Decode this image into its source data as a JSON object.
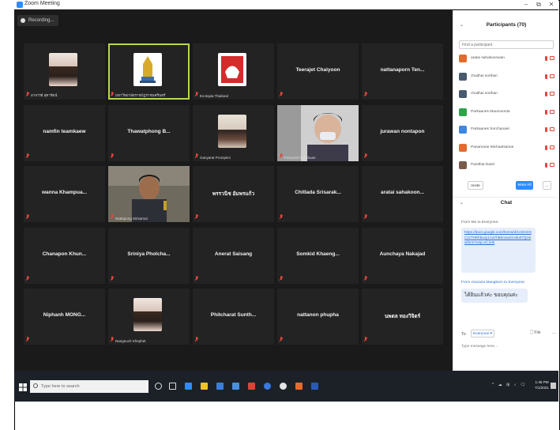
{
  "window": {
    "title": "Zoom Meeting",
    "minimize": "–",
    "maximize": "⧉",
    "close": "✕"
  },
  "recording": {
    "label": "Recording..."
  },
  "tiles": [
    {
      "name": "อาจารย์ สุดารัตน์",
      "type": "photo",
      "active": false
    },
    {
      "name": "มหาวิทยาลัยราชภัฏราชนครินทร์",
      "type": "logo",
      "active": true
    },
    {
      "name": "Ecotopia Thailand",
      "type": "logo2",
      "active": false
    },
    {
      "name": "Teerajet Chaiyoon",
      "type": "text",
      "active": false
    },
    {
      "name": "nattanaporn Ten...",
      "type": "text",
      "active": false
    },
    {
      "name": "namfin teamkaew",
      "type": "text",
      "active": false
    },
    {
      "name": "Thawatphong B...",
      "type": "text",
      "active": false
    },
    {
      "name": "Ganyarat Prompimi",
      "type": "photo2",
      "active": false
    },
    {
      "name": "Panyarat Rakchuan",
      "type": "cam",
      "active": false
    },
    {
      "name": "jurawan nontapon",
      "type": "text",
      "active": false
    },
    {
      "name": "wanna Khampua...",
      "type": "text",
      "active": false
    },
    {
      "name": "Nattapong Sirisamut",
      "type": "cam2",
      "active": false
    },
    {
      "name": "พรรวนิช อัมพรแก้ว",
      "type": "text",
      "active": false
    },
    {
      "name": "Chitlada Srisarak...",
      "type": "text",
      "active": false
    },
    {
      "name": "aratai sahakoon...",
      "type": "text",
      "active": false
    },
    {
      "name": "Chanapon Khun...",
      "type": "text",
      "active": false
    },
    {
      "name": "Sriniya Pholcha...",
      "type": "text",
      "active": false
    },
    {
      "name": "Anerat Saisang",
      "type": "text",
      "active": false
    },
    {
      "name": "Somkid Khaeng...",
      "type": "text",
      "active": false
    },
    {
      "name": "Aunchaya Nakajad",
      "type": "text",
      "active": false
    },
    {
      "name": "Niphanh MONG...",
      "type": "text",
      "active": false
    },
    {
      "name": "Nangnuch Khephet",
      "type": "photo3",
      "active": false
    },
    {
      "name": "Phitcharat Sunth...",
      "type": "text",
      "active": false
    },
    {
      "name": "nattanon phupha",
      "type": "text",
      "active": false
    },
    {
      "name": "นพดล ทองวิจิตร์",
      "type": "text",
      "active": false
    }
  ],
  "participants": {
    "title": "Participants (70)",
    "search_placeholder": "Find a participant",
    "list": [
      {
        "name": "aratai sahakoonwan",
        "initials": "A",
        "color": "#e8692e"
      },
      {
        "name": "chaithai sorthan",
        "initials": "CS",
        "color": "#4a5a6e"
      },
      {
        "name": "chaithai sorthan",
        "initials": "CS",
        "color": "#4a5a6e"
      },
      {
        "name": "Parkaanes Maumoonta",
        "initials": "P",
        "color": "#2fa34a"
      },
      {
        "name": "Parkaanes Sorchanaet",
        "initials": "PS",
        "color": "#3f86e0"
      },
      {
        "name": "Panarunee Michaelsanee",
        "initials": "PN",
        "color": "#e8692e"
      },
      {
        "name": "Panithat Dasri",
        "initials": "",
        "color": "#7a5a4a"
      }
    ],
    "invite": "Invite",
    "mute_all": "Mute All",
    "more": "..."
  },
  "chat": {
    "title": "Chat",
    "from1": "From Me to Everyone:",
    "link": "https://docs.google.com/forms/d/1r2iOmNCzz7NRh5voy1Aa7hB0ceasCHdu07Qzstwform?usp=sf_link",
    "from2": "From Aracaira Mangkorn to Everyone:",
    "message2": "ได้ยินแล้วค่ะ ขอบคุณค่ะ",
    "to_label": "To:",
    "to_value": "Everyone ▾",
    "file": "File",
    "more": "...",
    "input_placeholder": "Type message here..."
  },
  "taskbar": {
    "search_placeholder": "Type here to search",
    "clock_time": "1:45 PM",
    "clock_date": "7/1/2021",
    "tray": "^ ☁ ⊞ ♪ 🗨"
  }
}
